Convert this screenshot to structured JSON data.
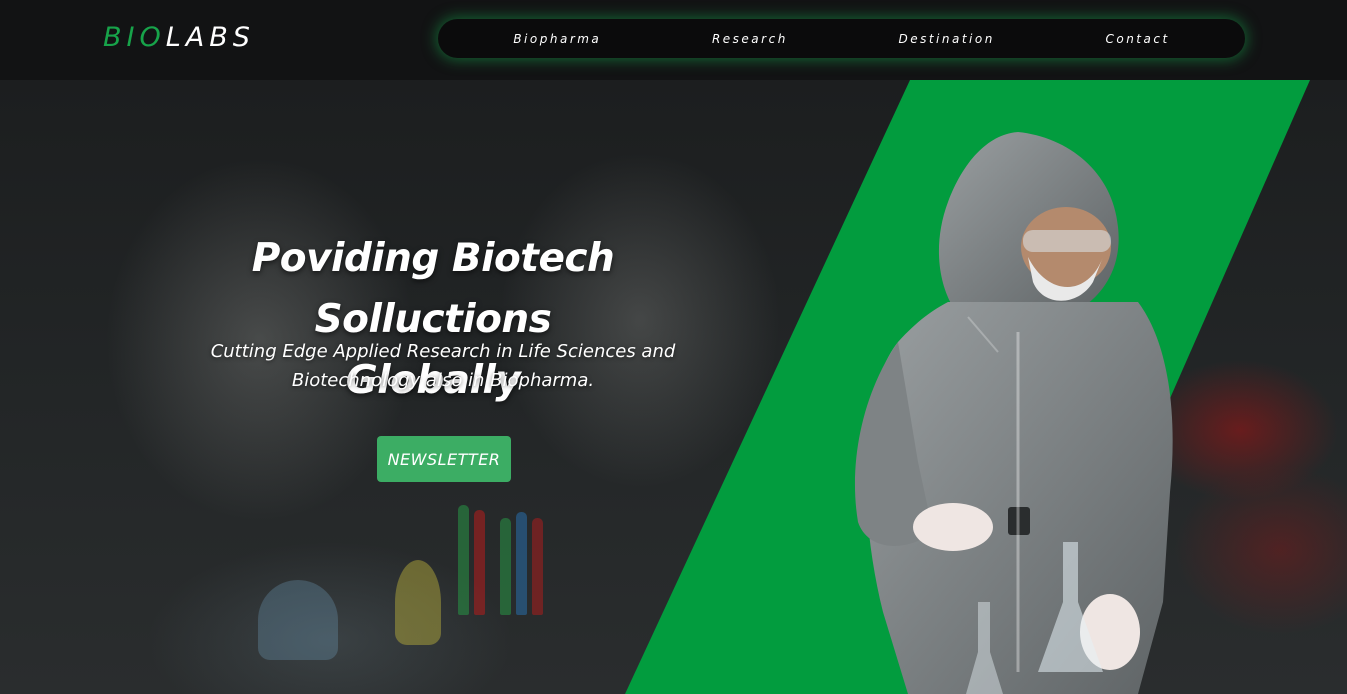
{
  "header": {
    "logo": {
      "part1": "BIO",
      "part2": "LABS"
    },
    "nav": [
      "Biopharma",
      "Research",
      "Destination",
      "Contact"
    ]
  },
  "hero": {
    "title_line1": "Poviding Biotech Solluctions",
    "title_line2": "Globally",
    "subtitle_line1": "Cutting Edge Applied Research in Life Sciences and",
    "subtitle_line2": "Biotechnology also in Biopharma.",
    "cta_label": "NEWSLETTER"
  },
  "colors": {
    "brand_green": "#17a34a",
    "panel_green": "#029c3e",
    "cta_green": "#3cad64",
    "background": "#121314"
  }
}
